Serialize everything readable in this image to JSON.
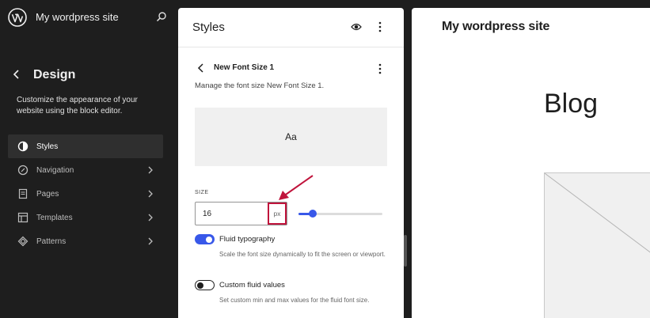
{
  "sidebar": {
    "site_title": "My wordpress site",
    "section_title": "Design",
    "section_desc": "Customize the appearance of your website using the block editor.",
    "items": [
      {
        "label": "Styles",
        "icon": "half-circle-icon",
        "active": true,
        "chevron": false
      },
      {
        "label": "Navigation",
        "icon": "compass-icon",
        "active": false,
        "chevron": true
      },
      {
        "label": "Pages",
        "icon": "page-icon",
        "active": false,
        "chevron": true
      },
      {
        "label": "Templates",
        "icon": "layout-icon",
        "active": false,
        "chevron": true
      },
      {
        "label": "Patterns",
        "icon": "diamond-icon",
        "active": false,
        "chevron": true
      }
    ]
  },
  "panel": {
    "title": "Styles",
    "sub_title": "New Font Size 1",
    "sub_desc": "Manage the font size New Font Size 1.",
    "preview_text": "Aa",
    "size_label": "SIZE",
    "size_value": "16",
    "unit": "px",
    "slider_fraction": 0.17,
    "fluid_label": "Fluid typography",
    "fluid_help": "Scale the font size dynamically to fit the screen or viewport.",
    "fluid_on": true,
    "custom_label": "Custom fluid values",
    "custom_help": "Set custom min and max values for the fluid font size.",
    "custom_on": false
  },
  "canvas": {
    "site_title": "My wordpress site",
    "heading": "Blog"
  },
  "colors": {
    "accent": "#3858e9",
    "highlight": "#c0143c",
    "sidebar_bg": "#1e1e1e"
  }
}
